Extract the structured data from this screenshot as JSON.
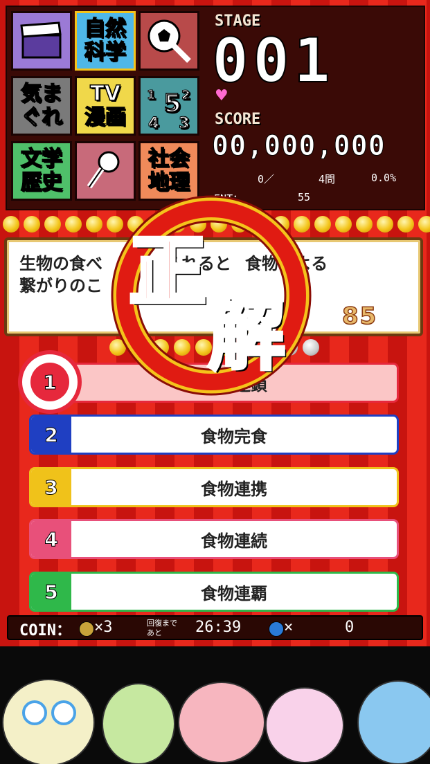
{
  "categories": [
    {
      "label": "",
      "icon": "movie-clapper-icon"
    },
    {
      "label": "自然\n科学",
      "icon": ""
    },
    {
      "label": "",
      "icon": "sports-ball-icon"
    },
    {
      "label": "気ま\nぐれ",
      "icon": ""
    },
    {
      "label": "TV\n漫画",
      "icon": ""
    },
    {
      "label": "",
      "icon": "numbers-icon"
    },
    {
      "label": "文学\n歴史",
      "icon": ""
    },
    {
      "label": "",
      "icon": "microphone-icon"
    },
    {
      "label": "社会\n地理",
      "icon": ""
    }
  ],
  "stage": {
    "label": "STAGE",
    "value": "001"
  },
  "score": {
    "label": "SCORE",
    "value": "00,000,000"
  },
  "stats": {
    "correct": "0／",
    "questions": "4問",
    "rate": "0.0%",
    "count_label": "…ENT：",
    "count_value": "55"
  },
  "question": {
    "text": "生物の食べ…されると…食物による繋がりのこ…",
    "line1": "生物の食べ",
    "line1b": "られると",
    "line1c": "食物による",
    "line2": "繋がりのこ",
    "timer": "85"
  },
  "result": {
    "glyph1": "正",
    "glyph2": "解"
  },
  "answers": [
    {
      "num": "1",
      "label": "食物連鎖",
      "color": "#e6283c",
      "selected": true
    },
    {
      "num": "2",
      "label": "食物完食",
      "color": "#1f3fc2"
    },
    {
      "num": "3",
      "label": "食物連携",
      "color": "#f0c21a"
    },
    {
      "num": "4",
      "label": "食物連続",
      "color": "#e8507a"
    },
    {
      "num": "5",
      "label": "食物連覇",
      "color": "#2fb84a"
    }
  ],
  "coin_bar": {
    "label": "COIN：",
    "coin_count": "×3",
    "recover_label_1": "回復まで",
    "recover_label_2": "あと",
    "timer": "26:39",
    "gem_count": "×",
    "gem_value": "0"
  }
}
